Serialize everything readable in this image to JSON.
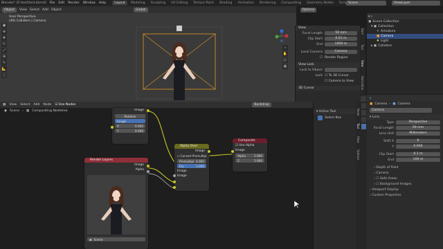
{
  "app": {
    "window_title": "Blender* [E:\\test\\test.blend]",
    "menu": [
      "File",
      "Edit",
      "Render",
      "Window",
      "Help"
    ],
    "workspaces": [
      "Layout",
      "Modeling",
      "Sculpting",
      "UV Editing",
      "Texture Paint",
      "Shading",
      "Animation",
      "Rendering",
      "Compositing",
      "Geometry Nodes",
      "Scripting"
    ],
    "active_workspace": "Layout",
    "scene_label": "Scene",
    "viewlayer_label": "ViewLayer"
  },
  "viewport": {
    "mode": "Object Mode",
    "menu": [
      "View",
      "Select",
      "Add",
      "Object"
    ],
    "transform": "Global",
    "options_label": "Options",
    "overlay_title": "User Perspective",
    "overlay_subtitle": "(46) Colliders | Camera",
    "accent_camera": "#e39a22"
  },
  "npanel": {
    "view_header": "View",
    "focal_length_label": "Focal Length",
    "focal_length_value": "50 mm",
    "clip_start_label": "Clip Start",
    "clip_start_value": "0.01 m",
    "end_label": "End",
    "end_value": "1000 m",
    "local_camera_label": "Local Camera",
    "local_camera_value": "Camera",
    "render_region_label": "Render Region",
    "view_lock_header": "View Lock",
    "lock_to_object_label": "Lock to Object",
    "lock_label": "Lock",
    "to_3d_cursor_label": "To 3D Cursor",
    "camera_to_view_label": "Camera to View",
    "cursor_header": "3D Cursor",
    "tabs": [
      "Item",
      "Tool",
      "View",
      "Animation"
    ]
  },
  "outliner": {
    "root": "Scene Collection",
    "items": [
      {
        "label": "Collection",
        "indent": 1
      },
      {
        "label": "Armature",
        "indent": 2
      },
      {
        "label": "Camera",
        "indent": 2,
        "selected": true
      },
      {
        "label": "Light",
        "indent": 2
      },
      {
        "label": "Colliders",
        "indent": 1
      }
    ]
  },
  "node_editor": {
    "menu": [
      "View",
      "Select",
      "Add",
      "Node"
    ],
    "use_nodes_label": "Use Nodes",
    "backdrop_label": "Backdrop",
    "breadcrumb": [
      "Scene",
      "Compositing Nodetree"
    ],
    "active_tool_header": "Active Tool",
    "select_box_label": "Select Box",
    "side_tabs": [
      "Node",
      "Tool",
      "View",
      "Options"
    ]
  },
  "nodes": {
    "translate": {
      "output_image": "Image",
      "relative_label": "Relative",
      "input_image": "Image",
      "x_label": "X",
      "x_value": "0.000",
      "y_label": "Y",
      "y_value": "0.000"
    },
    "alpha_over": {
      "title": "Alpha Over",
      "output_image": "Image",
      "convert_label": "Convert Premultipl...",
      "premultiplied_label": "Premultipl",
      "premultiplied_value": "0.000",
      "fac_label": "Fac",
      "fac_value": "1.000",
      "input_image_1": "Image",
      "input_image_2": "Image",
      "title_color": "#6b6b1f"
    },
    "composite": {
      "title": "Composite",
      "use_alpha_label": "Use Alpha",
      "input_image": "Image",
      "alpha_label": "Alpha",
      "alpha_value": "1.000",
      "z_label": "Z",
      "z_value": "1.000",
      "title_color": "#6b1f2d"
    },
    "render_layers": {
      "title": "Render Layers",
      "output_image": "Image",
      "output_alpha": "Alpha",
      "scene_label": "Scene",
      "title_color": "#8f2f3a"
    }
  },
  "properties": {
    "breadcrumb": [
      "Camera",
      "Camera"
    ],
    "data_name": "Camera",
    "lens_header": "Lens",
    "type_label": "Type",
    "type_value": "Perspective",
    "focal_label": "Focal Length",
    "focal_value": "50 mm",
    "lens_unit_label": "Lens Unit",
    "lens_unit_value": "Millimeters",
    "shift_x_label": "Shift X",
    "shift_x_value": "0",
    "shift_y_label": "Y",
    "shift_y_value": "0.000",
    "clip_start_label": "Clip Start",
    "clip_start_value": "0.1 m",
    "clip_end_label": "End",
    "clip_end_value": "100 m",
    "sections": [
      "Depth of Field",
      "Camera",
      "Safe Areas",
      "Background Images",
      "Viewport Display",
      "Custom Properties"
    ]
  }
}
